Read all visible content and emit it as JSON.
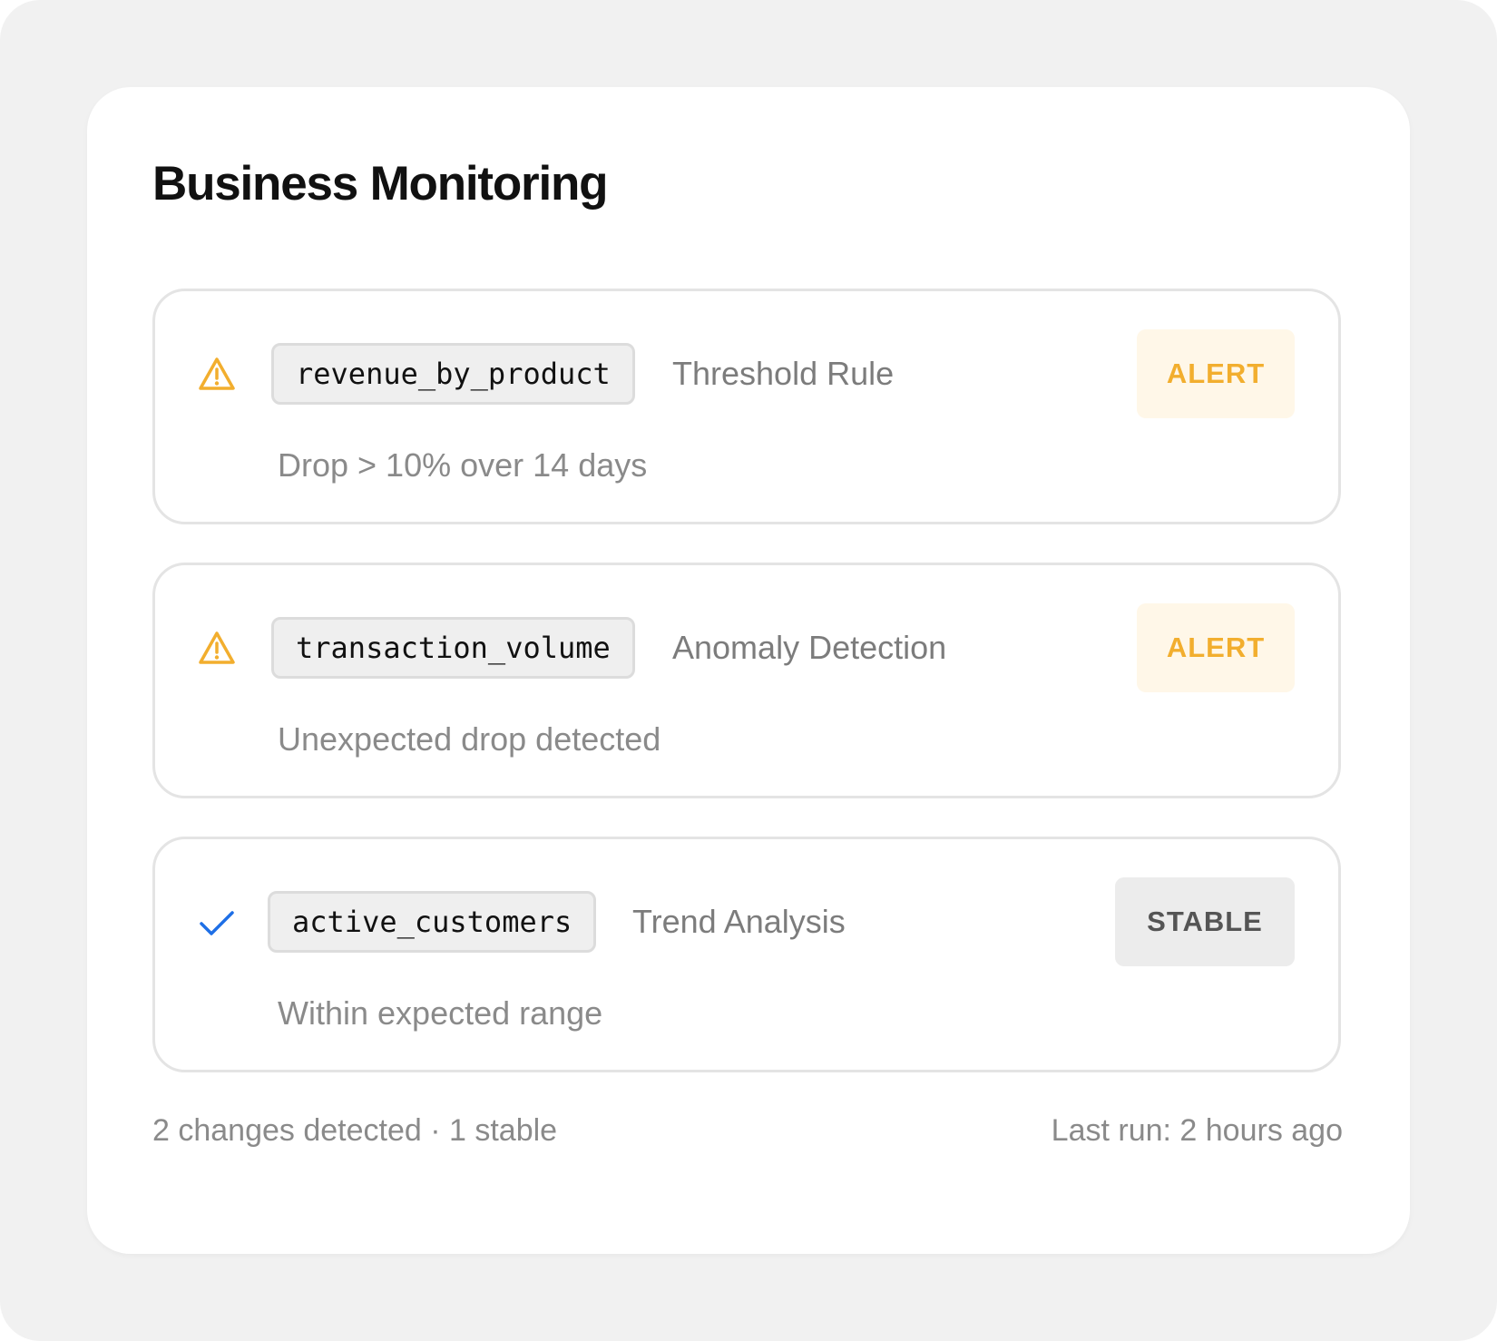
{
  "header": {
    "title": "Business Monitoring"
  },
  "monitors": [
    {
      "status_icon": "warning-triangle-icon",
      "metric": "revenue_by_product",
      "rule": "Threshold Rule",
      "description": "Drop > 10% over 14 days",
      "badge": "ALERT"
    },
    {
      "status_icon": "warning-triangle-icon",
      "metric": "transaction_volume",
      "rule": "Anomaly Detection",
      "description": "Unexpected drop detected",
      "badge": "ALERT"
    },
    {
      "status_icon": "checkmark-icon",
      "metric": "active_customers",
      "rule": "Trend Analysis",
      "description": "Within expected range",
      "badge": "STABLE"
    }
  ],
  "footer": {
    "summary": "2 changes detected · 1 stable",
    "last_run": "Last run: 2 hours ago"
  },
  "colors": {
    "alert": "#f2ae2e",
    "alert_bg": "#fff7e8",
    "check": "#1e6fe6",
    "stable_bg": "#ececec"
  }
}
